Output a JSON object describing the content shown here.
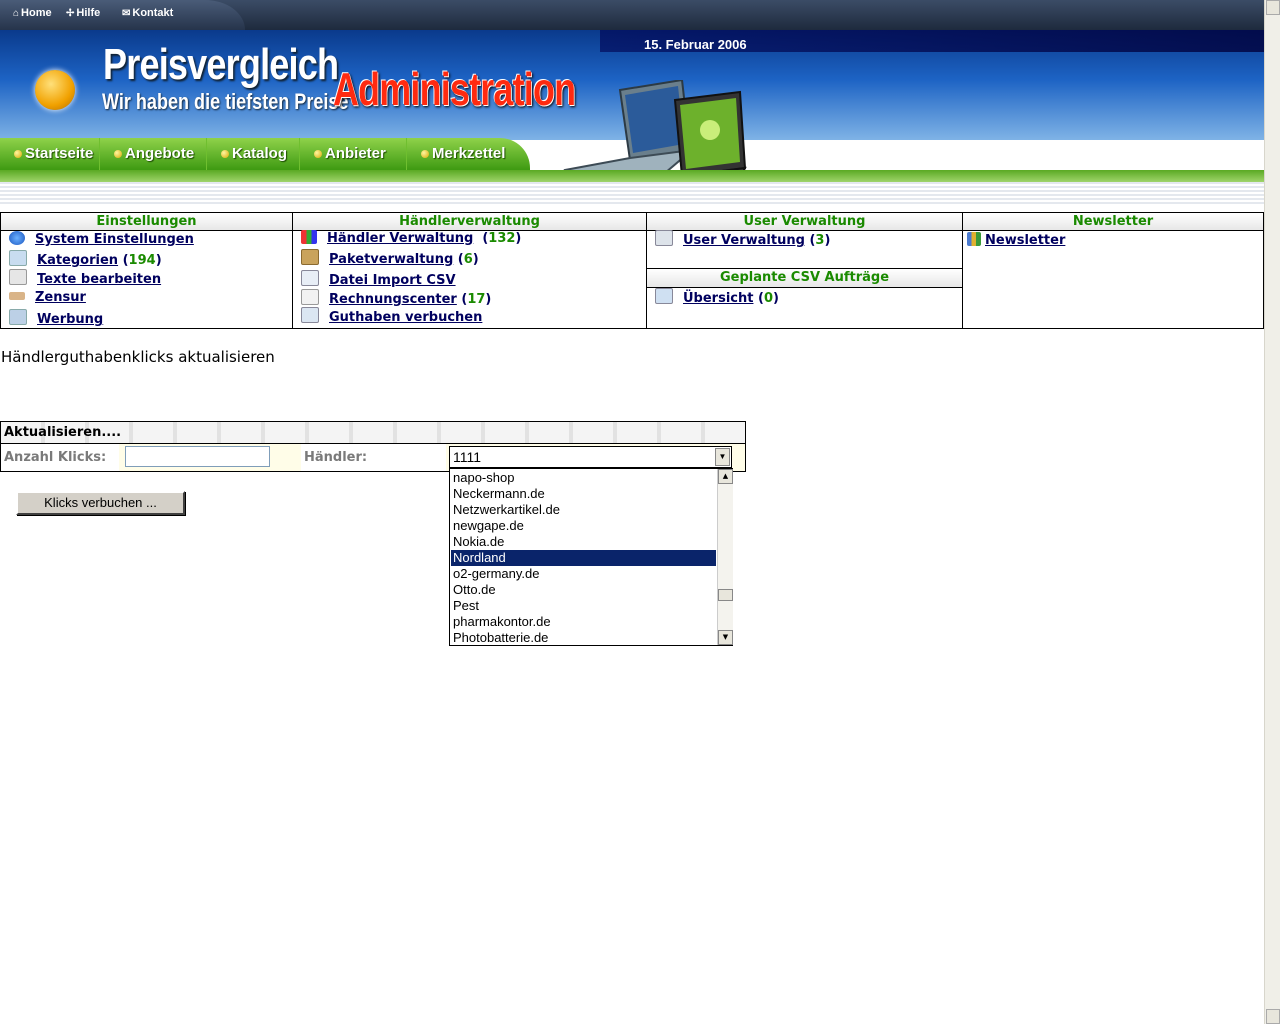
{
  "topnav": {
    "home": "Home",
    "help": "Hilfe",
    "contact": "Kontakt"
  },
  "header": {
    "title": "Preisvergleich",
    "slogan": "Wir haben die tiefsten Preise",
    "overlay": "Administration",
    "date": "15. Februar 2006"
  },
  "mainnav": [
    "Startseite",
    "Angebote",
    "Katalog",
    "Anbieter",
    "Merkzettel"
  ],
  "admin": {
    "einstellungen": {
      "title": "Einstellungen",
      "items": [
        {
          "label": "System Einstellungen",
          "count": ""
        },
        {
          "label": "Kategorien",
          "count": "194"
        },
        {
          "label": "Texte bearbeiten",
          "count": ""
        },
        {
          "label": "Zensur",
          "count": ""
        },
        {
          "label": "Werbung",
          "count": ""
        }
      ]
    },
    "haendler": {
      "title": "Händlerverwaltung",
      "items": [
        {
          "label": "Händler Verwaltung",
          "count": "132"
        },
        {
          "label": "Paketverwaltung",
          "count": "6"
        },
        {
          "label": "Datei Import CSV",
          "count": ""
        },
        {
          "label": "Rechnungscenter",
          "count": "17"
        },
        {
          "label": "Guthaben verbuchen",
          "count": ""
        }
      ]
    },
    "user": {
      "title": "User Verwaltung",
      "items": [
        {
          "label": "User Verwaltung",
          "count": "3"
        }
      ],
      "csv_title": "Geplante CSV Aufträge",
      "csv_items": [
        {
          "label": "Übersicht",
          "count": "0"
        }
      ]
    },
    "newsletter": {
      "title": "Newsletter",
      "items": [
        {
          "label": "Newsletter",
          "count": ""
        }
      ]
    }
  },
  "page": {
    "title": "Händlerguthabenklicks aktualisieren"
  },
  "form": {
    "header": "Aktualisieren....",
    "klicks_label": "Anzahl Klicks:",
    "klicks_value": "",
    "haendler_label": "Händler:",
    "haendler_value": "1111",
    "options": [
      "napo-shop",
      "Neckermann.de",
      "Netzwerkartikel.de",
      "newgape.de",
      "Nokia.de",
      "Nordland",
      "o2-germany.de",
      "Otto.de",
      "Pest",
      "pharmakontor.de",
      "Photobatterie.de"
    ],
    "selected_option": "Nordland",
    "submit_label": "Klicks verbuchen ..."
  },
  "colors": {
    "link": "#00005e",
    "count_green": "#1a8a00",
    "nav_green": "#3e9a12",
    "selected_bg": "#0a246a"
  }
}
